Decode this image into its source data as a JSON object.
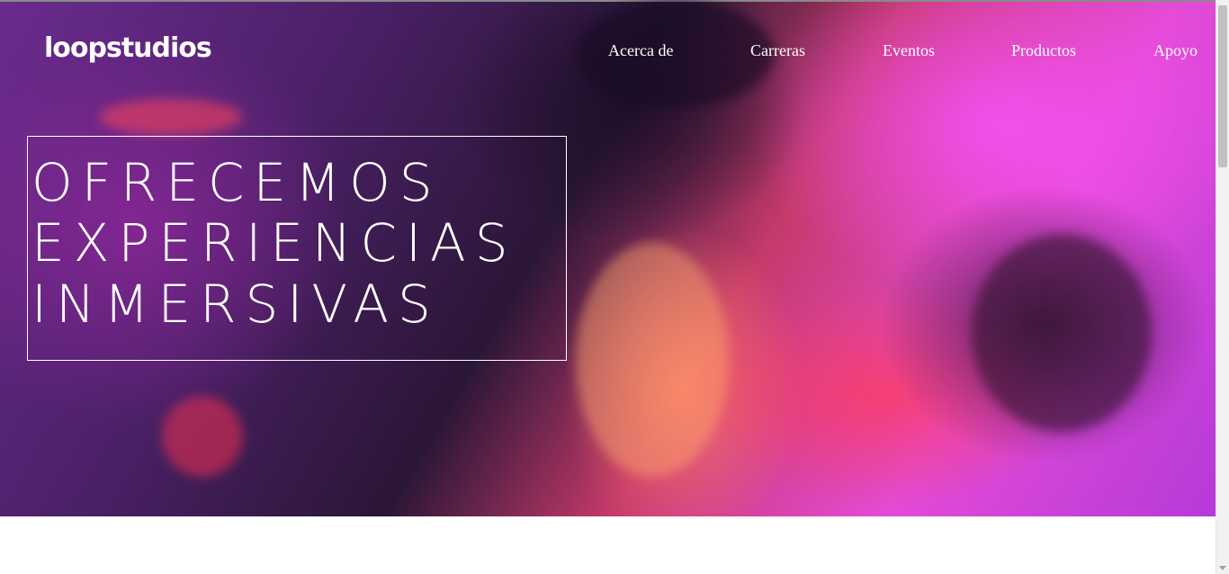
{
  "brand": {
    "logo_text": "loopstudios"
  },
  "nav": {
    "items": [
      {
        "label": "Acerca de"
      },
      {
        "label": "Carreras"
      },
      {
        "label": "Eventos"
      },
      {
        "label": "Productos"
      },
      {
        "label": "Apoyo"
      }
    ]
  },
  "hero": {
    "headline_lines": [
      "OFRECEMOS",
      "EXPERIENCIAS",
      "INMERSIVAS"
    ]
  },
  "colors": {
    "text": "#ffffff",
    "magenta": "#e34bd6",
    "pink": "#ff3c5a",
    "background": "#ffffff"
  }
}
